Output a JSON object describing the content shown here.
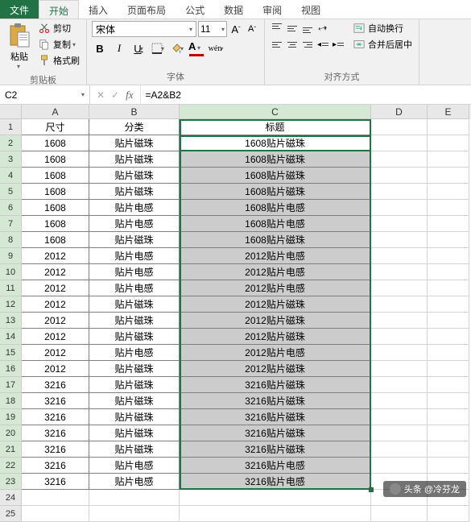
{
  "tabs": {
    "file": "文件",
    "home": "开始",
    "insert": "插入",
    "layout": "页面布局",
    "formula": "公式",
    "data": "数据",
    "review": "审阅",
    "view": "视图"
  },
  "ribbon": {
    "clipboard": {
      "paste": "粘贴",
      "cut": "剪切",
      "copy": "复制",
      "format_painter": "格式刷",
      "group": "剪贴板"
    },
    "font": {
      "name": "宋体",
      "size": "11",
      "group": "字体",
      "bold": "B",
      "italic": "I",
      "underline": "U",
      "letter_a": "A",
      "wen": "wén"
    },
    "align": {
      "group": "对齐方式",
      "wrap": "自动换行",
      "merge": "合并后居中",
      "angle": "ab"
    }
  },
  "namebox": "C2",
  "formula": "=A2&B2",
  "fx": "fx",
  "columns": [
    "A",
    "B",
    "C",
    "D",
    "E"
  ],
  "headers": {
    "A": "尺寸",
    "B": "分类",
    "C": "标题"
  },
  "rows": [
    {
      "n": 2,
      "a": "1608",
      "b": "贴片磁珠",
      "c": "1608贴片磁珠"
    },
    {
      "n": 3,
      "a": "1608",
      "b": "贴片磁珠",
      "c": "1608贴片磁珠"
    },
    {
      "n": 4,
      "a": "1608",
      "b": "贴片磁珠",
      "c": "1608贴片磁珠"
    },
    {
      "n": 5,
      "a": "1608",
      "b": "贴片磁珠",
      "c": "1608贴片磁珠"
    },
    {
      "n": 6,
      "a": "1608",
      "b": "贴片电感",
      "c": "1608贴片电感"
    },
    {
      "n": 7,
      "a": "1608",
      "b": "贴片电感",
      "c": "1608贴片电感"
    },
    {
      "n": 8,
      "a": "1608",
      "b": "贴片磁珠",
      "c": "1608贴片磁珠"
    },
    {
      "n": 9,
      "a": "2012",
      "b": "贴片电感",
      "c": "2012贴片电感"
    },
    {
      "n": 10,
      "a": "2012",
      "b": "贴片电感",
      "c": "2012贴片电感"
    },
    {
      "n": 11,
      "a": "2012",
      "b": "贴片电感",
      "c": "2012贴片电感"
    },
    {
      "n": 12,
      "a": "2012",
      "b": "贴片磁珠",
      "c": "2012贴片磁珠"
    },
    {
      "n": 13,
      "a": "2012",
      "b": "贴片磁珠",
      "c": "2012贴片磁珠"
    },
    {
      "n": 14,
      "a": "2012",
      "b": "贴片磁珠",
      "c": "2012贴片磁珠"
    },
    {
      "n": 15,
      "a": "2012",
      "b": "贴片电感",
      "c": "2012贴片电感"
    },
    {
      "n": 16,
      "a": "2012",
      "b": "贴片磁珠",
      "c": "2012贴片磁珠"
    },
    {
      "n": 17,
      "a": "3216",
      "b": "贴片磁珠",
      "c": "3216贴片磁珠"
    },
    {
      "n": 18,
      "a": "3216",
      "b": "贴片磁珠",
      "c": "3216贴片磁珠"
    },
    {
      "n": 19,
      "a": "3216",
      "b": "贴片磁珠",
      "c": "3216贴片磁珠"
    },
    {
      "n": 20,
      "a": "3216",
      "b": "贴片磁珠",
      "c": "3216贴片磁珠"
    },
    {
      "n": 21,
      "a": "3216",
      "b": "贴片磁珠",
      "c": "3216贴片磁珠"
    },
    {
      "n": 22,
      "a": "3216",
      "b": "贴片电感",
      "c": "3216贴片电感"
    },
    {
      "n": 23,
      "a": "3216",
      "b": "贴片电感",
      "c": "3216贴片电感"
    }
  ],
  "empty_rows": [
    24,
    25
  ],
  "watermark": "头条 @冷芬龙"
}
